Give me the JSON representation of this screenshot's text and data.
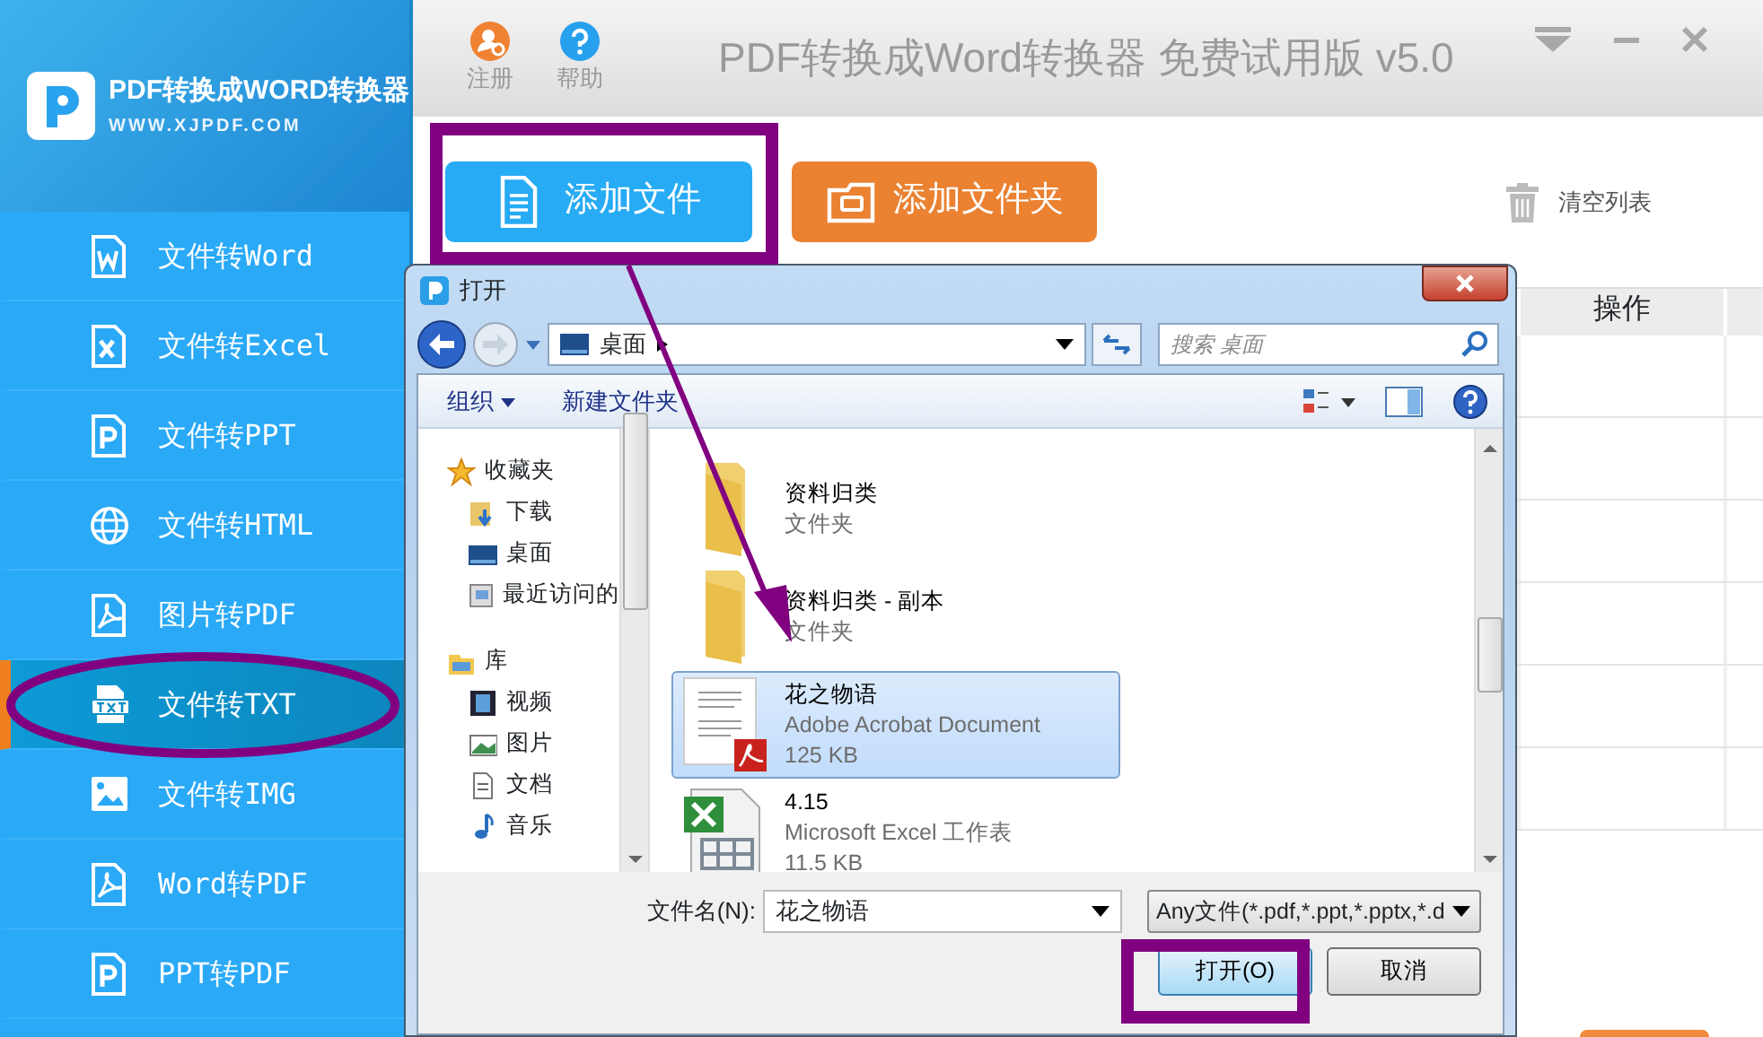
{
  "app": {
    "logo_title": "PDF转换成WORD转换器",
    "logo_url": "WWW.XJPDF.COM"
  },
  "sidebar": {
    "items": [
      {
        "label": "文件转Word",
        "kind": "word",
        "selected": false
      },
      {
        "label": "文件转Excel",
        "kind": "excel",
        "selected": false
      },
      {
        "label": "文件转PPT",
        "kind": "ppt",
        "selected": false
      },
      {
        "label": "文件转HTML",
        "kind": "html",
        "selected": false
      },
      {
        "label": "图片转PDF",
        "kind": "pdf",
        "selected": false
      },
      {
        "label": "文件转TXT",
        "kind": "txt",
        "selected": true
      },
      {
        "label": "文件转IMG",
        "kind": "image",
        "selected": false
      },
      {
        "label": "Word转PDF",
        "kind": "pdf",
        "selected": false
      },
      {
        "label": "PPT转PDF",
        "kind": "ppt",
        "selected": false
      }
    ]
  },
  "title_bar": {
    "buttons": [
      {
        "label": "注册",
        "kind": "register"
      },
      {
        "label": "帮助",
        "kind": "help"
      }
    ],
    "title": "PDF转换成Word转换器 免费试用版 v5.0"
  },
  "toolbar": {
    "buttons": [
      {
        "label": "添加文件",
        "kind": "file"
      },
      {
        "label": "添加文件夹",
        "kind": "folder"
      }
    ],
    "clear_button": "清空列表"
  },
  "table": {
    "columns": [
      "操作"
    ]
  },
  "dialog": {
    "title": "打开",
    "address": "桌面",
    "search": {
      "placeholder": "搜索 桌面"
    },
    "toolbar": [
      "组织",
      "新建文件夹"
    ],
    "nav": [
      {
        "label": "收藏夹",
        "kind": "star",
        "children": [
          {
            "label": "下载",
            "kind": "download"
          },
          {
            "label": "桌面",
            "kind": "desktop"
          },
          {
            "label": "最近访问的",
            "kind": "recent"
          }
        ]
      },
      {
        "label": "库",
        "kind": "library",
        "children": [
          {
            "label": "视频",
            "kind": "video"
          },
          {
            "label": "图片",
            "kind": "picture"
          },
          {
            "label": "文档",
            "kind": "document"
          },
          {
            "label": "音乐",
            "kind": "music"
          }
        ]
      }
    ],
    "files": [
      {
        "name": "资料归类",
        "type": "文件夹",
        "kind": "folder",
        "selected": false
      },
      {
        "name": "资料归类 - 副本",
        "type": "文件夹",
        "kind": "folder",
        "selected": false
      },
      {
        "name": "花之物语",
        "type": "Adobe Acrobat Document",
        "size": "125 KB",
        "kind": "pdf",
        "selected": true
      },
      {
        "name": "4.15",
        "type": "Microsoft Excel 工作表",
        "size": "11.5 KB",
        "kind": "excel",
        "selected": false
      }
    ],
    "file_name_label": "文件名(N):",
    "file_name": "花之物语",
    "file_type": "Any文件(*.pdf,*.ppt,*.pptx,*.d",
    "buttons": [
      "打开(O)",
      "取消"
    ]
  },
  "annotations": [
    {
      "kind": "box"
    },
    {
      "kind": "ellipse"
    },
    {
      "kind": "arrow"
    },
    {
      "kind": "box"
    }
  ]
}
